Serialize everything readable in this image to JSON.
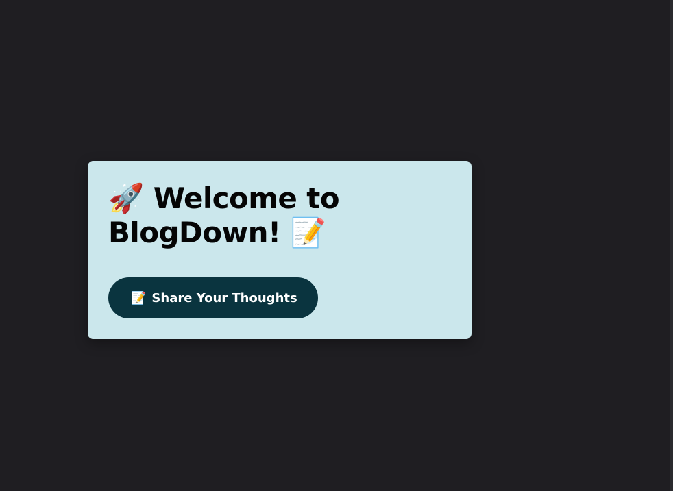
{
  "hero": {
    "leading_icon": "🚀",
    "title_text": "Welcome to BlogDown!",
    "trailing_icon": "📝",
    "icon_names": [
      "rocket-icon",
      "memo-icon"
    ]
  },
  "cta": {
    "icon": "📝",
    "icon_name": "memo-icon",
    "label": "Share Your Thoughts"
  },
  "colors": {
    "page_background": "#1f1e22",
    "card_background": "#cbe7ec",
    "button_background": "#0a343f",
    "button_text": "#ffffff",
    "title_text": "#050505"
  }
}
